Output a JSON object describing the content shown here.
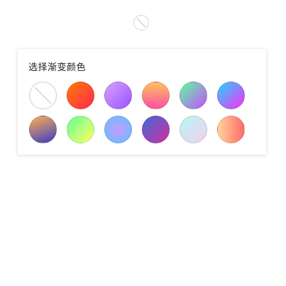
{
  "picker": {
    "title": "选择渐变颜色",
    "trigger_icon": "no-color-icon",
    "swatches": [
      {
        "name": "none",
        "icon": "no-color-icon"
      },
      {
        "name": "orange-red",
        "from": "#ff7a00",
        "to": "#ff2a4f",
        "angle": 135
      },
      {
        "name": "violet",
        "from": "#d7a2ff",
        "to": "#9a52ff",
        "angle": 135
      },
      {
        "name": "peach-pink",
        "from": "#ffc15e",
        "to": "#ff4fa3",
        "angle": 180
      },
      {
        "name": "aqua-violet",
        "from": "#5dff9f",
        "to": "#c94cff",
        "angle": 135
      },
      {
        "name": "cyan-magenta",
        "from": "#1fd8ff",
        "to": "#ff2cf0",
        "angle": 135
      },
      {
        "name": "sunset-indigo",
        "from": "#ffb04e",
        "to": "#3b3cc9",
        "angle": 160
      },
      {
        "name": "lime-yellow",
        "from": "#63ff95",
        "to": "#ffff63",
        "angle": 135
      },
      {
        "name": "sky-lilac",
        "type": "radial",
        "inner": "#c69bff",
        "outer": "#5ec3ff"
      },
      {
        "name": "indigo-magenta",
        "from": "#3d6bd4",
        "to": "#d42ea3",
        "angle": 135
      },
      {
        "name": "mist-blush",
        "from": "#b8f5f5",
        "to": "#f2d0f0",
        "angle": 135
      },
      {
        "name": "apricot-coral",
        "from": "#ffd49a",
        "to": "#ff6b6b",
        "angle": 90
      }
    ]
  }
}
